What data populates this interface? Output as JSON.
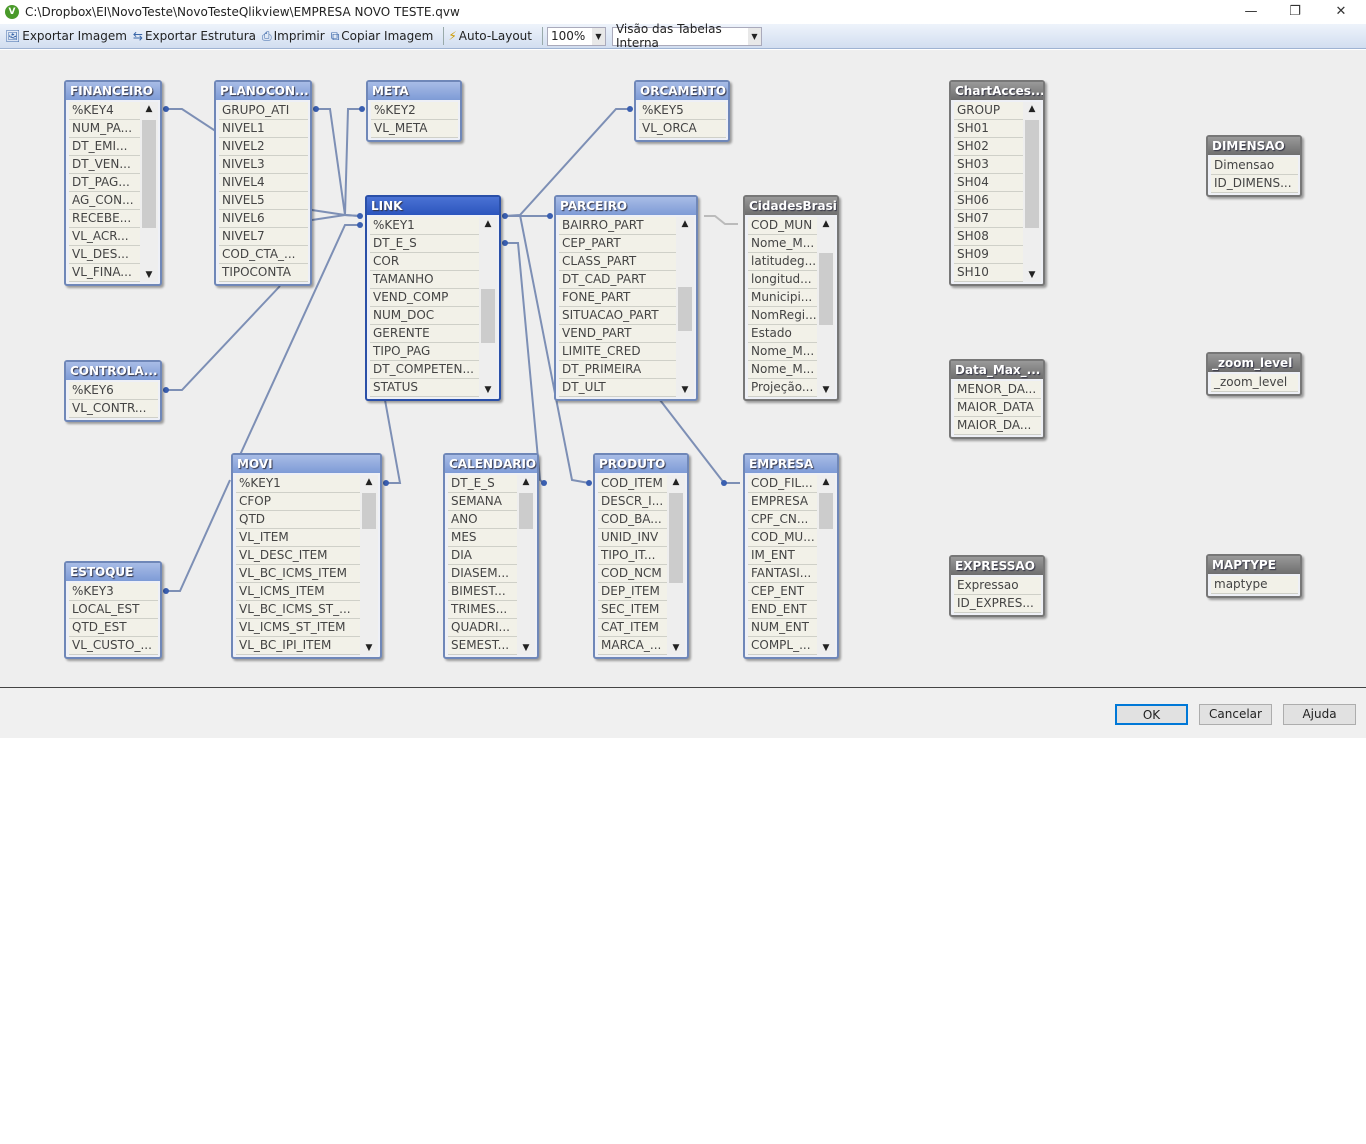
{
  "window": {
    "title": "C:\\Dropbox\\EI\\NovoTeste\\NovoTesteQlikview\\EMPRESA NOVO TESTE.qvw",
    "logo": "V",
    "minimize": "—",
    "restore": "❐",
    "close": "✕"
  },
  "toolbar": {
    "export_image": "Exportar Imagem",
    "export_structure": "Exportar Estrutura",
    "print": "Imprimir",
    "copy_image": "Copiar Imagem",
    "auto_layout": "Auto-Layout",
    "zoom": "100%",
    "view": "Visão das Tabelas Interna"
  },
  "tables": [
    {
      "name": "FINANCEIRO",
      "style": "blue",
      "fields": [
        "%KEY4",
        "NUM_PA...",
        "DT_EMI...",
        "DT_VEN...",
        "DT_PAG...",
        "AG_CON...",
        "RECEBE...",
        "VL_ACR...",
        "VL_DES...",
        "VL_FINA..."
      ]
    },
    {
      "name": "PLANOCON...",
      "style": "blue",
      "fields": [
        "GRUPO_ATI",
        "NIVEL1",
        "NIVEL2",
        "NIVEL3",
        "NIVEL4",
        "NIVEL5",
        "NIVEL6",
        "NIVEL7",
        "COD_CTA_...",
        "TIPOCONTA"
      ]
    },
    {
      "name": "META",
      "style": "blue",
      "fields": [
        "%KEY2",
        "VL_META"
      ]
    },
    {
      "name": "ORCAMENTO",
      "style": "blue",
      "fields": [
        "%KEY5",
        "VL_ORCA"
      ]
    },
    {
      "name": "LINK",
      "style": "selected",
      "fields": [
        "%KEY1",
        "DT_E_S",
        "COR",
        "TAMANHO",
        "VEND_COMP",
        "NUM_DOC",
        "GERENTE",
        "TIPO_PAG",
        "DT_COMPETEN...",
        "STATUS"
      ]
    },
    {
      "name": "PARCEIRO",
      "style": "blue",
      "fields": [
        "BAIRRO_PART",
        "CEP_PART",
        "CLASS_PART",
        "DT_CAD_PART",
        "FONE_PART",
        "SITUACAO_PART",
        "VEND_PART",
        "LIMITE_CRED",
        "DT_PRIMEIRA",
        "DT_ULT"
      ]
    },
    {
      "name": "CidadesBrasil",
      "style": "gray",
      "fields": [
        "COD_MUN",
        "Nome_M...",
        "latitudeg...",
        "longitud...",
        "Municipi...",
        "NomRegi...",
        "Estado",
        "Nome_M...",
        "Nome_M...",
        "Projeção..."
      ]
    },
    {
      "name": "ChartAcces...",
      "style": "gray",
      "fields": [
        "GROUP",
        "SH01",
        "SH02",
        "SH03",
        "SH04",
        "SH06",
        "SH07",
        "SH08",
        "SH09",
        "SH10"
      ]
    },
    {
      "name": "DIMENSAO",
      "style": "gray",
      "fields": [
        "Dimensao",
        "ID_DIMENS..."
      ]
    },
    {
      "name": "CONTROLA...",
      "style": "blue",
      "fields": [
        "%KEY6",
        "VL_CONTR..."
      ]
    },
    {
      "name": "Data_Max_...",
      "style": "gray",
      "fields": [
        "MENOR_DA...",
        "MAIOR_DATA",
        "MAIOR_DA..."
      ]
    },
    {
      "name": "_zoom_level",
      "style": "gray",
      "fields": [
        "_zoom_level"
      ]
    },
    {
      "name": "MOVI",
      "style": "blue",
      "fields": [
        "%KEY1",
        "CFOP",
        "QTD",
        "VL_ITEM",
        "VL_DESC_ITEM",
        "VL_BC_ICMS_ITEM",
        "VL_ICMS_ITEM",
        "VL_BC_ICMS_ST_...",
        "VL_ICMS_ST_ITEM",
        "VL_BC_IPI_ITEM"
      ]
    },
    {
      "name": "CALENDARIO",
      "style": "blue",
      "fields": [
        "DT_E_S",
        "SEMANA",
        "ANO",
        "MES",
        "DIA",
        "DIASEM...",
        "BIMEST...",
        "TRIMES...",
        "QUADRI...",
        "SEMEST..."
      ]
    },
    {
      "name": "PRODUTO",
      "style": "blue",
      "fields": [
        "COD_ITEM",
        "DESCR_I...",
        "COD_BA...",
        "UNID_INV",
        "TIPO_IT...",
        "COD_NCM",
        "DEP_ITEM",
        "SEC_ITEM",
        "CAT_ITEM",
        "MARCA_..."
      ]
    },
    {
      "name": "EMPRESA",
      "style": "blue",
      "fields": [
        "COD_FIL...",
        "EMPRESA",
        "CPF_CN...",
        "COD_MU...",
        "IM_ENT",
        "FANTASI...",
        "CEP_ENT",
        "END_ENT",
        "NUM_ENT",
        "COMPL_..."
      ]
    },
    {
      "name": "ESTOQUE",
      "style": "blue",
      "fields": [
        "%KEY3",
        "LOCAL_EST",
        "QTD_EST",
        "VL_CUSTO_..."
      ]
    },
    {
      "name": "EXPRESSAO",
      "style": "gray",
      "fields": [
        "Expressao",
        "ID_EXPRES..."
      ]
    },
    {
      "name": "MAPTYPE",
      "style": "gray",
      "fields": [
        "maptype"
      ]
    }
  ],
  "buttons": {
    "ok": "OK",
    "cancel": "Cancelar",
    "help": "Ajuda"
  }
}
